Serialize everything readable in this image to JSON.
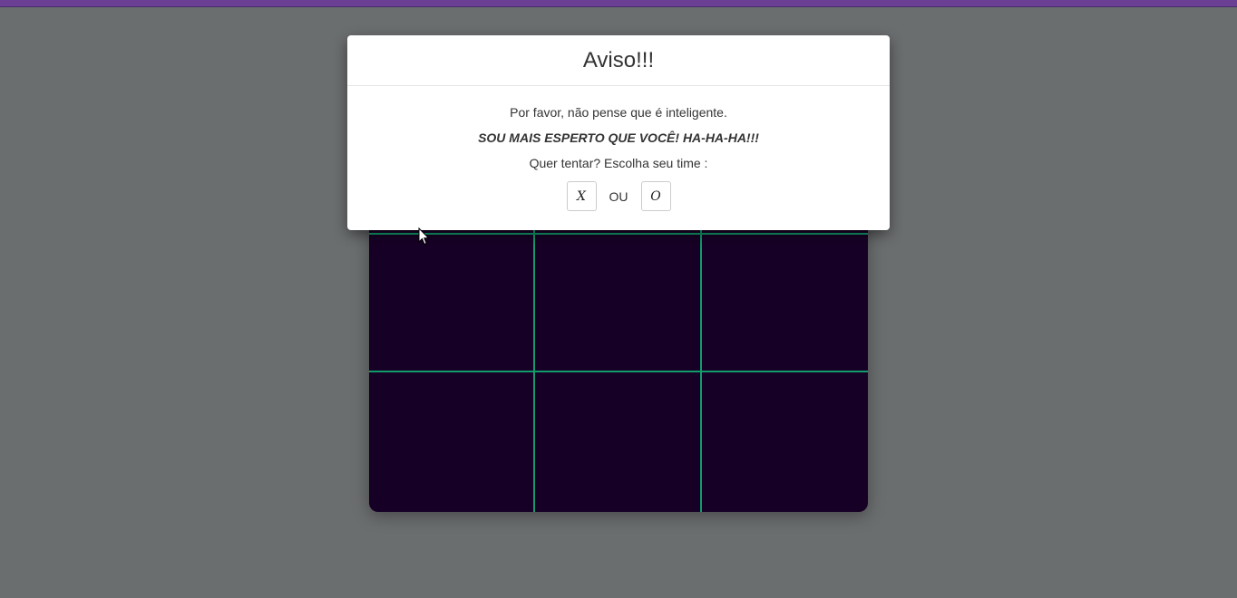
{
  "modal": {
    "title": "Aviso!!!",
    "line1": "Por favor, não pense que é inteligente.",
    "line2": "SOU MAIS ESPERTO QUE VOCÊ! HA-HA-HA!!!",
    "line3": "Quer tentar? Escolha seu time :",
    "option_x": "X",
    "separator": "OU",
    "option_o": "O"
  },
  "colors": {
    "backdrop": "#6b6e6f",
    "board": "#170026",
    "grid": "#129c6c",
    "top_strip": "#6a3f94"
  },
  "board": {
    "rows": 3,
    "cols": 3,
    "cells": [
      "",
      "",
      "",
      "",
      "",
      "",
      "",
      "",
      ""
    ]
  }
}
